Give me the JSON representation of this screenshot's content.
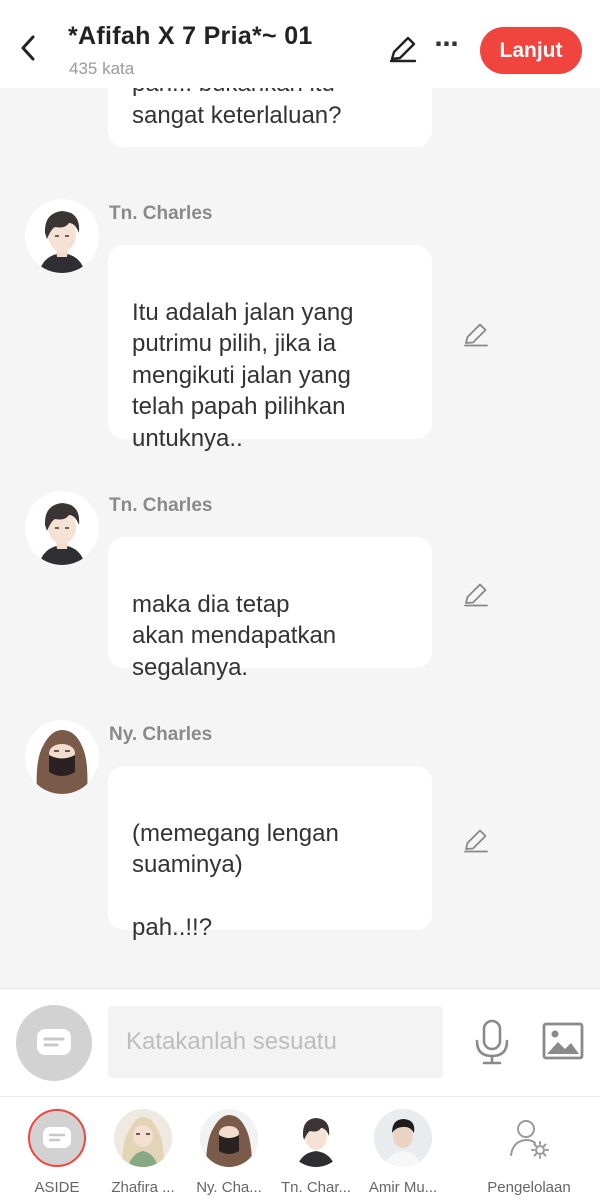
{
  "header": {
    "title": "*Afifah X 7 Pria*~ 01",
    "word_count": "435 kata",
    "next_label": "Lanjut"
  },
  "messages": [
    {
      "speaker": "",
      "text": "pah... bukankah itu\nsangat keterlaluan?"
    },
    {
      "speaker": "Tn. Charles",
      "text": "Itu adalah jalan yang\nputrimu pilih, jika ia\nmengikuti jalan yang\ntelah papah pilihkan\nuntuknya.."
    },
    {
      "speaker": "Tn. Charles",
      "text": "maka dia tetap\nakan mendapatkan\nsegalanya."
    },
    {
      "speaker": "Ny. Charles",
      "text": "(memegang lengan\nsuaminya)\n\npah..!!?"
    }
  ],
  "input": {
    "placeholder": "Katakanlah sesuatu"
  },
  "characters": [
    {
      "label": "ASIDE"
    },
    {
      "label": "Zhafira ..."
    },
    {
      "label": "Ny. Cha..."
    },
    {
      "label": "Tn. Char..."
    },
    {
      "label": "Amir Mu..."
    },
    {
      "label": "Pengelolaan"
    }
  ],
  "colors": {
    "accent": "#f0443f",
    "background": "#f5f5f5",
    "bubble": "#ffffff"
  }
}
